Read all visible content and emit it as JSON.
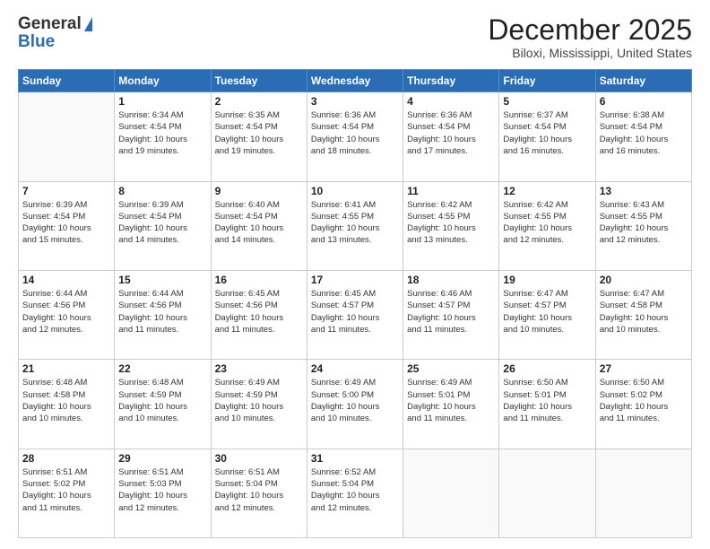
{
  "header": {
    "logo_general": "General",
    "logo_blue": "Blue",
    "title": "December 2025",
    "location": "Biloxi, Mississippi, United States"
  },
  "days_of_week": [
    "Sunday",
    "Monday",
    "Tuesday",
    "Wednesday",
    "Thursday",
    "Friday",
    "Saturday"
  ],
  "weeks": [
    [
      {
        "day": "",
        "info": ""
      },
      {
        "day": "1",
        "info": "Sunrise: 6:34 AM\nSunset: 4:54 PM\nDaylight: 10 hours\nand 19 minutes."
      },
      {
        "day": "2",
        "info": "Sunrise: 6:35 AM\nSunset: 4:54 PM\nDaylight: 10 hours\nand 19 minutes."
      },
      {
        "day": "3",
        "info": "Sunrise: 6:36 AM\nSunset: 4:54 PM\nDaylight: 10 hours\nand 18 minutes."
      },
      {
        "day": "4",
        "info": "Sunrise: 6:36 AM\nSunset: 4:54 PM\nDaylight: 10 hours\nand 17 minutes."
      },
      {
        "day": "5",
        "info": "Sunrise: 6:37 AM\nSunset: 4:54 PM\nDaylight: 10 hours\nand 16 minutes."
      },
      {
        "day": "6",
        "info": "Sunrise: 6:38 AM\nSunset: 4:54 PM\nDaylight: 10 hours\nand 16 minutes."
      }
    ],
    [
      {
        "day": "7",
        "info": "Sunrise: 6:39 AM\nSunset: 4:54 PM\nDaylight: 10 hours\nand 15 minutes."
      },
      {
        "day": "8",
        "info": "Sunrise: 6:39 AM\nSunset: 4:54 PM\nDaylight: 10 hours\nand 14 minutes."
      },
      {
        "day": "9",
        "info": "Sunrise: 6:40 AM\nSunset: 4:54 PM\nDaylight: 10 hours\nand 14 minutes."
      },
      {
        "day": "10",
        "info": "Sunrise: 6:41 AM\nSunset: 4:55 PM\nDaylight: 10 hours\nand 13 minutes."
      },
      {
        "day": "11",
        "info": "Sunrise: 6:42 AM\nSunset: 4:55 PM\nDaylight: 10 hours\nand 13 minutes."
      },
      {
        "day": "12",
        "info": "Sunrise: 6:42 AM\nSunset: 4:55 PM\nDaylight: 10 hours\nand 12 minutes."
      },
      {
        "day": "13",
        "info": "Sunrise: 6:43 AM\nSunset: 4:55 PM\nDaylight: 10 hours\nand 12 minutes."
      }
    ],
    [
      {
        "day": "14",
        "info": "Sunrise: 6:44 AM\nSunset: 4:56 PM\nDaylight: 10 hours\nand 12 minutes."
      },
      {
        "day": "15",
        "info": "Sunrise: 6:44 AM\nSunset: 4:56 PM\nDaylight: 10 hours\nand 11 minutes."
      },
      {
        "day": "16",
        "info": "Sunrise: 6:45 AM\nSunset: 4:56 PM\nDaylight: 10 hours\nand 11 minutes."
      },
      {
        "day": "17",
        "info": "Sunrise: 6:45 AM\nSunset: 4:57 PM\nDaylight: 10 hours\nand 11 minutes."
      },
      {
        "day": "18",
        "info": "Sunrise: 6:46 AM\nSunset: 4:57 PM\nDaylight: 10 hours\nand 11 minutes."
      },
      {
        "day": "19",
        "info": "Sunrise: 6:47 AM\nSunset: 4:57 PM\nDaylight: 10 hours\nand 10 minutes."
      },
      {
        "day": "20",
        "info": "Sunrise: 6:47 AM\nSunset: 4:58 PM\nDaylight: 10 hours\nand 10 minutes."
      }
    ],
    [
      {
        "day": "21",
        "info": "Sunrise: 6:48 AM\nSunset: 4:58 PM\nDaylight: 10 hours\nand 10 minutes."
      },
      {
        "day": "22",
        "info": "Sunrise: 6:48 AM\nSunset: 4:59 PM\nDaylight: 10 hours\nand 10 minutes."
      },
      {
        "day": "23",
        "info": "Sunrise: 6:49 AM\nSunset: 4:59 PM\nDaylight: 10 hours\nand 10 minutes."
      },
      {
        "day": "24",
        "info": "Sunrise: 6:49 AM\nSunset: 5:00 PM\nDaylight: 10 hours\nand 10 minutes."
      },
      {
        "day": "25",
        "info": "Sunrise: 6:49 AM\nSunset: 5:01 PM\nDaylight: 10 hours\nand 11 minutes."
      },
      {
        "day": "26",
        "info": "Sunrise: 6:50 AM\nSunset: 5:01 PM\nDaylight: 10 hours\nand 11 minutes."
      },
      {
        "day": "27",
        "info": "Sunrise: 6:50 AM\nSunset: 5:02 PM\nDaylight: 10 hours\nand 11 minutes."
      }
    ],
    [
      {
        "day": "28",
        "info": "Sunrise: 6:51 AM\nSunset: 5:02 PM\nDaylight: 10 hours\nand 11 minutes."
      },
      {
        "day": "29",
        "info": "Sunrise: 6:51 AM\nSunset: 5:03 PM\nDaylight: 10 hours\nand 12 minutes."
      },
      {
        "day": "30",
        "info": "Sunrise: 6:51 AM\nSunset: 5:04 PM\nDaylight: 10 hours\nand 12 minutes."
      },
      {
        "day": "31",
        "info": "Sunrise: 6:52 AM\nSunset: 5:04 PM\nDaylight: 10 hours\nand 12 minutes."
      },
      {
        "day": "",
        "info": ""
      },
      {
        "day": "",
        "info": ""
      },
      {
        "day": "",
        "info": ""
      }
    ]
  ]
}
